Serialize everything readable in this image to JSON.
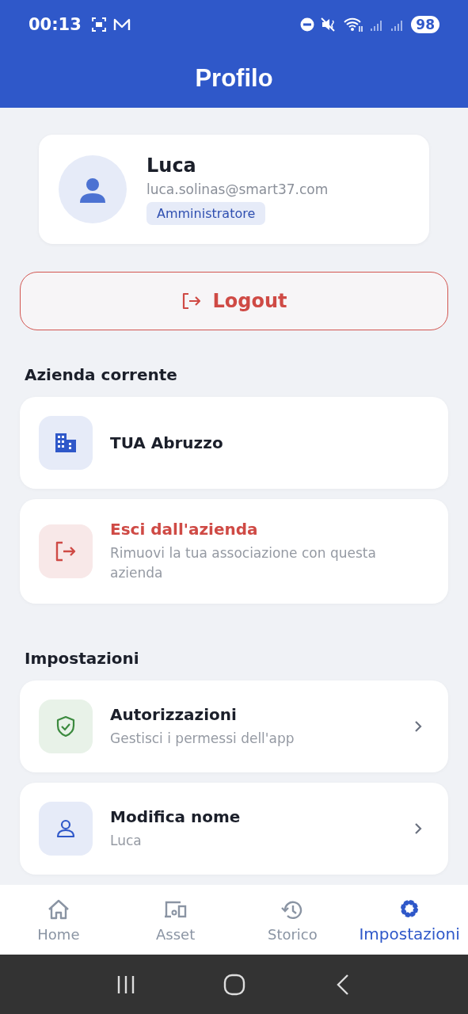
{
  "status_bar": {
    "time": "00:13",
    "battery": "98"
  },
  "header": {
    "title": "Profilo"
  },
  "profile": {
    "name": "Luca",
    "email": "luca.solinas@smart37.com",
    "role": "Amministratore"
  },
  "logout": {
    "label": "Logout"
  },
  "sections": [
    {
      "title": "Azienda corrente",
      "items": [
        {
          "kind": "plain",
          "title": "TUA Abruzzo"
        },
        {
          "kind": "danger",
          "title": "Esci dall'azienda",
          "subtitle": "Rimuovi la tua associazione con questa azienda"
        }
      ]
    },
    {
      "title": "Impostazioni",
      "items": [
        {
          "kind": "link",
          "title": "Autorizzazioni",
          "subtitle": "Gestisci i permessi dell'app"
        },
        {
          "kind": "link",
          "title": "Modifica nome",
          "subtitle": "Luca"
        }
      ]
    }
  ],
  "nav": [
    {
      "label": "Home",
      "selected": false
    },
    {
      "label": "Asset",
      "selected": false
    },
    {
      "label": "Storico",
      "selected": false
    },
    {
      "label": "Impostazioni",
      "selected": true
    }
  ]
}
